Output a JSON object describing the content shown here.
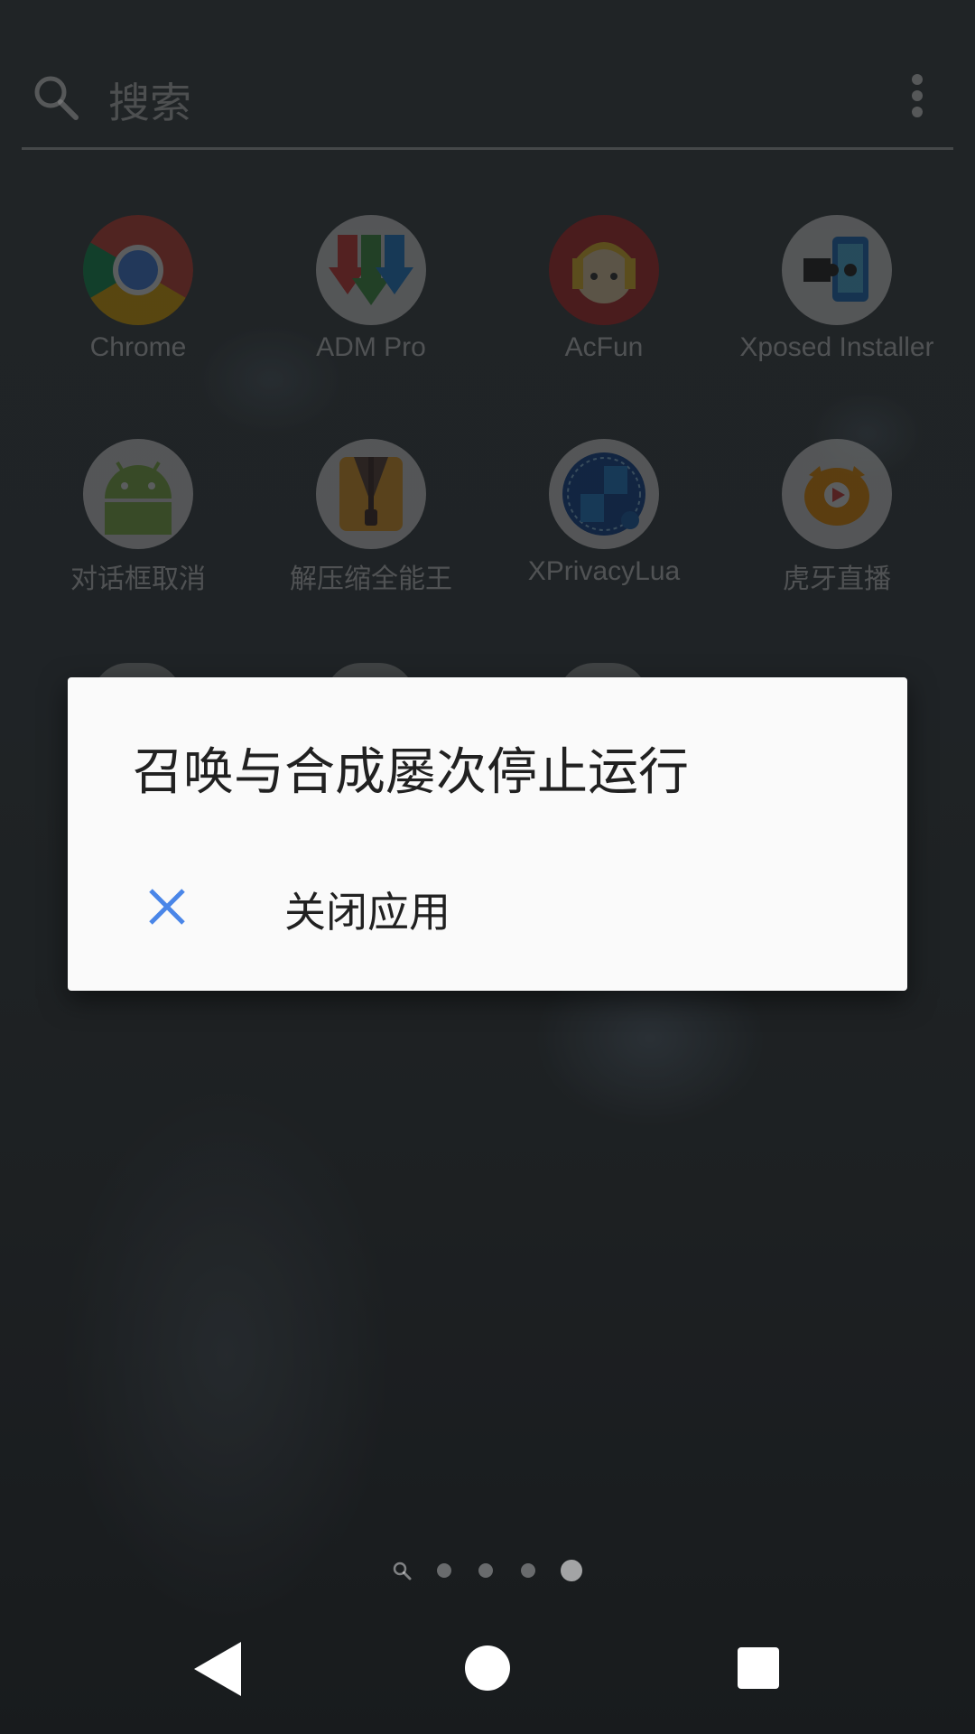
{
  "search": {
    "placeholder": "搜索"
  },
  "apps": [
    {
      "name": "Chrome",
      "icon": "chrome-icon"
    },
    {
      "name": "ADM Pro",
      "icon": "adm-pro-icon"
    },
    {
      "name": "AcFun",
      "icon": "acfun-icon"
    },
    {
      "name": "Xposed Installer",
      "icon": "xposed-installer-icon"
    },
    {
      "name": "对话框取消",
      "icon": "android-icon"
    },
    {
      "name": "解压缩全能王",
      "icon": "zip-icon"
    },
    {
      "name": "XPrivacyLua",
      "icon": "xprivacylua-icon"
    },
    {
      "name": "虎牙直播",
      "icon": "huya-icon"
    }
  ],
  "dialog": {
    "title": "召唤与合成屡次停止运行",
    "option_label": "关闭应用",
    "accent_color": "#4a86e8"
  },
  "page_indicator": {
    "pages": 4,
    "active_page": 4
  },
  "nav": {
    "back": "back-icon",
    "home": "home-icon",
    "recents": "recents-icon"
  }
}
